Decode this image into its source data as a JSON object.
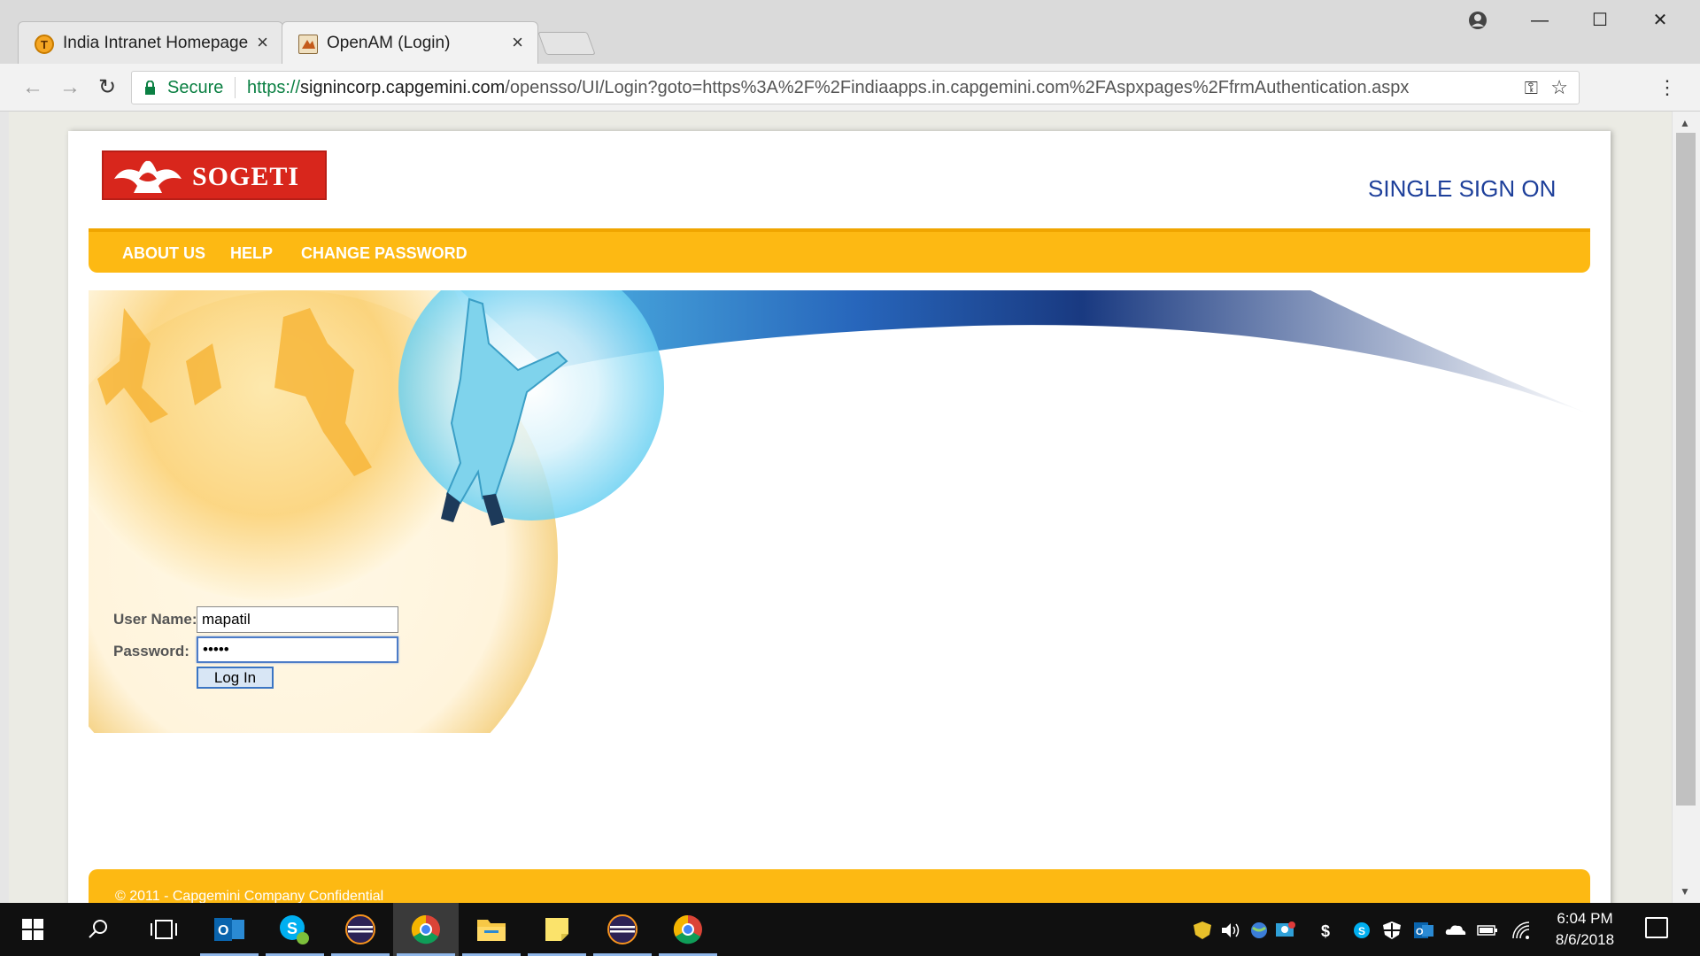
{
  "browser": {
    "tabs": [
      {
        "title": "India Intranet Homepage",
        "close": "×",
        "active": false,
        "favicon": "intranet-favicon"
      },
      {
        "title": "OpenAM (Login)",
        "close": "×",
        "active": true,
        "favicon": "openam-favicon"
      }
    ],
    "window_controls": {
      "minimize": "—",
      "maximize": "☐",
      "close": "✕"
    },
    "nav": {
      "back": "←",
      "forward": "→",
      "reload": "↻"
    },
    "omnibox": {
      "secure_label": "Secure",
      "url_scheme": "https://",
      "url_host": "signincorp.capgemini.com",
      "url_path": "/opensso/UI/Login?goto=https%3A%2F%2Findiaapps.in.capgemini.com%2FAspxpages%2FfrmAuthentication.aspx"
    },
    "icons": {
      "key": "⚿",
      "star": "☆",
      "menu": "⋮"
    }
  },
  "page": {
    "logo_text": "SOGETI",
    "heading": "SINGLE SIGN ON",
    "nav": [
      {
        "label": "ABOUT US"
      },
      {
        "label": "HELP"
      },
      {
        "label": "CHANGE PASSWORD"
      }
    ],
    "form": {
      "username_label": "User Name:",
      "username_value": "mapatil",
      "password_label": "Password:",
      "password_value": "*****",
      "login_button": "Log In"
    },
    "footer": "© 2011 - Capgemini Company Confidential"
  },
  "taskbar": {
    "clock_time": "6:04 PM",
    "clock_date": "8/6/2018",
    "apps": [
      "start-icon",
      "search-icon",
      "task-view-icon",
      "outlook-icon",
      "skype-icon",
      "eclipse-icon",
      "chrome-icon",
      "file-explorer-icon",
      "sticky-notes-icon",
      "eclipse-icon",
      "chrome-icon"
    ]
  },
  "colors": {
    "accent_yellow": "#fdb913",
    "sso_blue": "#1d3f9a",
    "logo_red": "#d8261c",
    "secure_green": "#0b8043"
  }
}
